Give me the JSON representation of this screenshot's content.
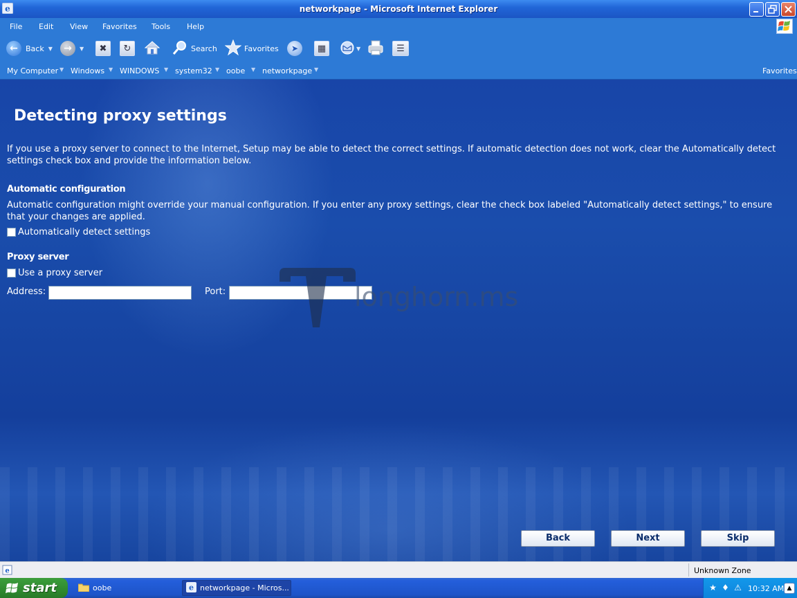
{
  "window": {
    "title": "networkpage - Microsoft Internet Explorer",
    "icon": "ie-icon",
    "controls": [
      "minimize",
      "restore",
      "close"
    ]
  },
  "menu": {
    "items": [
      "File",
      "Edit",
      "View",
      "Favorites",
      "Tools",
      "Help"
    ]
  },
  "toolbar": {
    "back_label": "Back",
    "search_label": "Search",
    "favorites_label": "Favorites"
  },
  "address": {
    "crumbs": [
      "My Computer",
      "Windows",
      "WINDOWS",
      "system32",
      "oobe",
      "networkpage"
    ],
    "favorites_label": "Favorites"
  },
  "page": {
    "title": "Detecting proxy settings",
    "intro": "If you use a proxy server to connect to the Internet, Setup may be able to detect the correct settings. If automatic detection does not work, clear the Automatically detect settings check box and provide the information below.",
    "auto_heading": "Automatic configuration",
    "auto_desc": "Automatic configuration might override your manual configuration. If you enter any proxy settings, clear the check box labeled \"Automatically detect settings,\" to ensure that your changes are applied.",
    "auto_checkbox_label": "Automatically detect settings",
    "auto_checkbox_checked": false,
    "proxy_heading": "Proxy server",
    "proxy_checkbox_label": "Use a proxy server",
    "proxy_checkbox_checked": false,
    "address_label": "Address:",
    "address_value": "",
    "port_label": "Port:",
    "port_value": "",
    "watermark_text": "longhorn.ms",
    "buttons": {
      "back": "Back",
      "next": "Next",
      "skip": "Skip"
    }
  },
  "status": {
    "zone": "Unknown Zone"
  },
  "taskbar": {
    "start_label": "start",
    "tasks": [
      {
        "label": "oobe",
        "icon": "folder-icon",
        "active": false
      },
      {
        "label": "networkpage - Micros...",
        "icon": "ie-icon",
        "active": true
      }
    ],
    "clock": "10:32 AM"
  },
  "colors": {
    "titlebar": "#2166d8",
    "toolbar": "#2d7ad6",
    "content_bg": "#1a4dac",
    "taskbar": "#245edb",
    "start_green": "#2f8a2f",
    "tray": "#1398ea"
  }
}
